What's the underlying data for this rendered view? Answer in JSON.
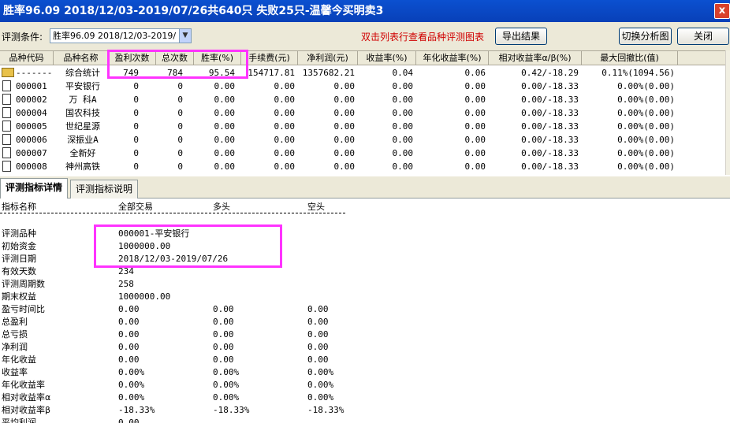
{
  "window": {
    "title": "胜率96.09   2018/12/03-2019/07/26共640只  失败25只-温馨今买明卖3",
    "close_glyph": "x"
  },
  "toolbar": {
    "cond_label": "评测条件:",
    "cond_value": "胜率96.09  2018/12/03-2019/",
    "hint": "双击列表行查看品种评测图表",
    "export_label": "导出结果",
    "switch_label": "切换分析图",
    "close_label": "关闭"
  },
  "table": {
    "headers": [
      "品种代码",
      "品种名称",
      "盈利次数",
      "总次数",
      "胜率(%)",
      "手续费(元)",
      "净利润(元)",
      "收益率(%)",
      "年化收益率(%)",
      "相对收益率α/β(%)",
      "最大回撤比(值)"
    ],
    "rows": [
      [
        "-------",
        "综合统计",
        "749",
        "784",
        "95.54",
        "154717.81",
        "1357682.21",
        "0.04",
        "0.06",
        "0.42/-18.29",
        "0.11%(1094.56)"
      ],
      [
        "000001",
        "平安银行",
        "0",
        "0",
        "0.00",
        "0.00",
        "0.00",
        "0.00",
        "0.00",
        "0.00/-18.33",
        "0.00%(0.00)"
      ],
      [
        "000002",
        "万 科A",
        "0",
        "0",
        "0.00",
        "0.00",
        "0.00",
        "0.00",
        "0.00",
        "0.00/-18.33",
        "0.00%(0.00)"
      ],
      [
        "000004",
        "国农科技",
        "0",
        "0",
        "0.00",
        "0.00",
        "0.00",
        "0.00",
        "0.00",
        "0.00/-18.33",
        "0.00%(0.00)"
      ],
      [
        "000005",
        "世纪星源",
        "0",
        "0",
        "0.00",
        "0.00",
        "0.00",
        "0.00",
        "0.00",
        "0.00/-18.33",
        "0.00%(0.00)"
      ],
      [
        "000006",
        "深振业A",
        "0",
        "0",
        "0.00",
        "0.00",
        "0.00",
        "0.00",
        "0.00",
        "0.00/-18.33",
        "0.00%(0.00)"
      ],
      [
        "000007",
        "全新好",
        "0",
        "0",
        "0.00",
        "0.00",
        "0.00",
        "0.00",
        "0.00",
        "0.00/-18.33",
        "0.00%(0.00)"
      ],
      [
        "000008",
        "神州高铁",
        "0",
        "0",
        "0.00",
        "0.00",
        "0.00",
        "0.00",
        "0.00",
        "0.00/-18.33",
        "0.00%(0.00)"
      ]
    ]
  },
  "tabs": [
    "评测指标详情",
    "评测指标说明"
  ],
  "detail": {
    "headers": [
      "指标名称",
      "全部交易",
      "多头",
      "空头"
    ],
    "rows": [
      [
        "评测品种",
        "000001-平安银行",
        "",
        ""
      ],
      [
        "初始资金",
        "1000000.00",
        "",
        ""
      ],
      [
        "评测日期",
        "2018/12/03-2019/07/26",
        "",
        ""
      ],
      [
        "有效天数",
        "234",
        "",
        ""
      ],
      [
        "评测周期数",
        "258",
        "",
        ""
      ],
      [
        "期末权益",
        "1000000.00",
        "",
        ""
      ],
      [
        "盈亏时间比",
        "0.00",
        "0.00",
        "0.00"
      ],
      [
        "总盈利",
        "0.00",
        "0.00",
        "0.00"
      ],
      [
        "总亏损",
        "0.00",
        "0.00",
        "0.00"
      ],
      [
        "净利润",
        "0.00",
        "0.00",
        "0.00"
      ],
      [
        "年化收益",
        "0.00",
        "0.00",
        "0.00"
      ],
      [
        "收益率",
        "0.00%",
        "0.00%",
        "0.00%"
      ],
      [
        "年化收益率",
        "0.00%",
        "0.00%",
        "0.00%"
      ],
      [
        "相对收益率α",
        "0.00%",
        "0.00%",
        "0.00%"
      ],
      [
        "相对收益率β",
        "-18.33%",
        "-18.33%",
        "-18.33%"
      ],
      [
        "平均利润",
        "0.00",
        "",
        ""
      ]
    ]
  },
  "colors": {
    "highlight": "#ff33ff",
    "hint": "#d00000",
    "titlebar": "#0840b8"
  }
}
